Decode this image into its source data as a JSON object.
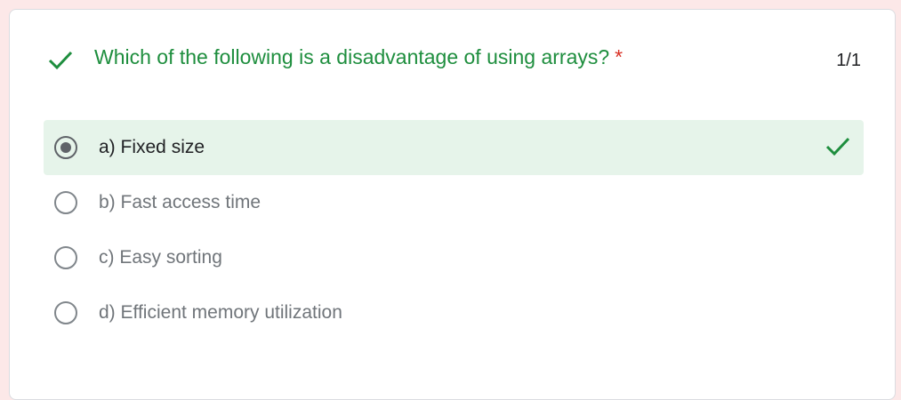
{
  "question": {
    "title": "Which of the following is a disadvantage of using arrays?",
    "required_marker": "*",
    "score": "1/1",
    "status_icon": "check-icon",
    "options": [
      {
        "label": "a) Fixed size",
        "selected": true,
        "correct": true
      },
      {
        "label": "b) Fast access time",
        "selected": false,
        "correct": false
      },
      {
        "label": "c) Easy sorting",
        "selected": false,
        "correct": false
      },
      {
        "label": "d) Efficient memory utilization",
        "selected": false,
        "correct": false
      }
    ]
  },
  "colors": {
    "correct_green": "#1e8e3e",
    "correct_bg": "#e6f4ea",
    "required_red": "#d93025",
    "page_bg": "#fce8e8"
  }
}
